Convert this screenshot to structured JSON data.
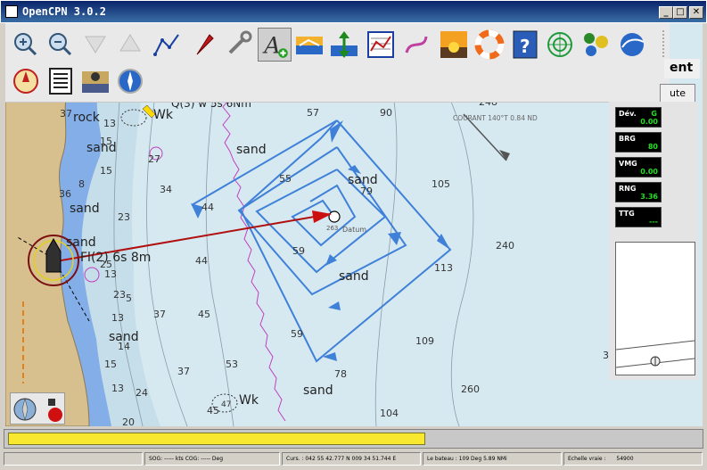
{
  "window": {
    "title": "OpenCPN 3.0.2",
    "minimize": "_",
    "maximize": "□",
    "close": "✕"
  },
  "toolbar": {
    "tools": [
      {
        "name": "zoom-in"
      },
      {
        "name": "zoom-out"
      },
      {
        "name": "scale-in"
      },
      {
        "name": "scale-out"
      },
      {
        "name": "route"
      },
      {
        "name": "follow-boat"
      },
      {
        "name": "settings"
      },
      {
        "name": "text"
      },
      {
        "name": "current"
      },
      {
        "name": "tide"
      },
      {
        "name": "route-manager"
      },
      {
        "name": "track"
      },
      {
        "name": "color-scheme"
      },
      {
        "name": "mob"
      },
      {
        "name": "help"
      },
      {
        "name": "radar"
      },
      {
        "name": "dashboard"
      },
      {
        "name": "google-earth"
      },
      {
        "name": "compass-gps"
      },
      {
        "name": "logbook"
      },
      {
        "name": "weather-fax"
      },
      {
        "name": "position-compass"
      }
    ]
  },
  "right_buttons": {
    "label1": "ent",
    "label2": "ute"
  },
  "chart": {
    "depths": [
      {
        "t": "57"
      },
      {
        "t": "90"
      },
      {
        "t": "248"
      },
      {
        "t": "105"
      },
      {
        "t": "55"
      },
      {
        "t": "79"
      },
      {
        "t": "44"
      },
      {
        "t": "59"
      },
      {
        "t": "240"
      },
      {
        "t": "113"
      },
      {
        "t": "44"
      },
      {
        "t": "37"
      },
      {
        "t": "45"
      },
      {
        "t": "59"
      },
      {
        "t": "109"
      },
      {
        "t": "78"
      },
      {
        "t": "53"
      },
      {
        "t": "37"
      },
      {
        "t": "260"
      },
      {
        "t": "104"
      },
      {
        "t": "45"
      },
      {
        "t": "47"
      },
      {
        "t": "24"
      },
      {
        "t": "20"
      },
      {
        "t": "15"
      },
      {
        "t": "13"
      },
      {
        "t": "27"
      },
      {
        "t": "34"
      },
      {
        "t": "23"
      },
      {
        "t": "8"
      },
      {
        "t": "15"
      },
      {
        "t": "13"
      },
      {
        "t": "37"
      },
      {
        "t": "36"
      },
      {
        "t": "25"
      },
      {
        "t": "23"
      },
      {
        "t": "14"
      },
      {
        "t": "15"
      },
      {
        "t": "13"
      },
      {
        "t": "5"
      },
      {
        "t": "13"
      },
      {
        "t": "3"
      }
    ],
    "labels": [
      {
        "t": "sand"
      },
      {
        "t": "sand"
      },
      {
        "t": "sand"
      },
      {
        "t": "sand"
      },
      {
        "t": "sand"
      },
      {
        "t": "sand"
      },
      {
        "t": "sand"
      },
      {
        "t": "sand"
      },
      {
        "t": "rock"
      },
      {
        "t": "Wk"
      },
      {
        "t": "Wk"
      }
    ],
    "light_label": "Fl(2) 6s 8m",
    "light_label_top": "Q(3) w 5s 6Nm",
    "current_label": "COURANT 140°T 0.84 ND",
    "datum_label": "Datum",
    "datum_num": "263"
  },
  "instruments": [
    {
      "label": "Dév.",
      "unit": "G",
      "value": "0.00"
    },
    {
      "label": "BRG",
      "unit": "",
      "value": "80"
    },
    {
      "label": "VMG",
      "unit": "",
      "value": "0.00"
    },
    {
      "label": "RNG",
      "unit": "",
      "value": "3.36"
    },
    {
      "label": "TTG",
      "unit": "",
      "value": "---"
    }
  ],
  "status": {
    "sog_cog": "SOG: ----- kts  COG: ----- Deg",
    "cursor": "Curs. : 042 55 42.777 N 009 34 51.744 E",
    "bearing": "Le bateau : 109 Deg   5.89 NMi",
    "scale_label": "Echelle vraie :",
    "scale_value": "54900"
  }
}
